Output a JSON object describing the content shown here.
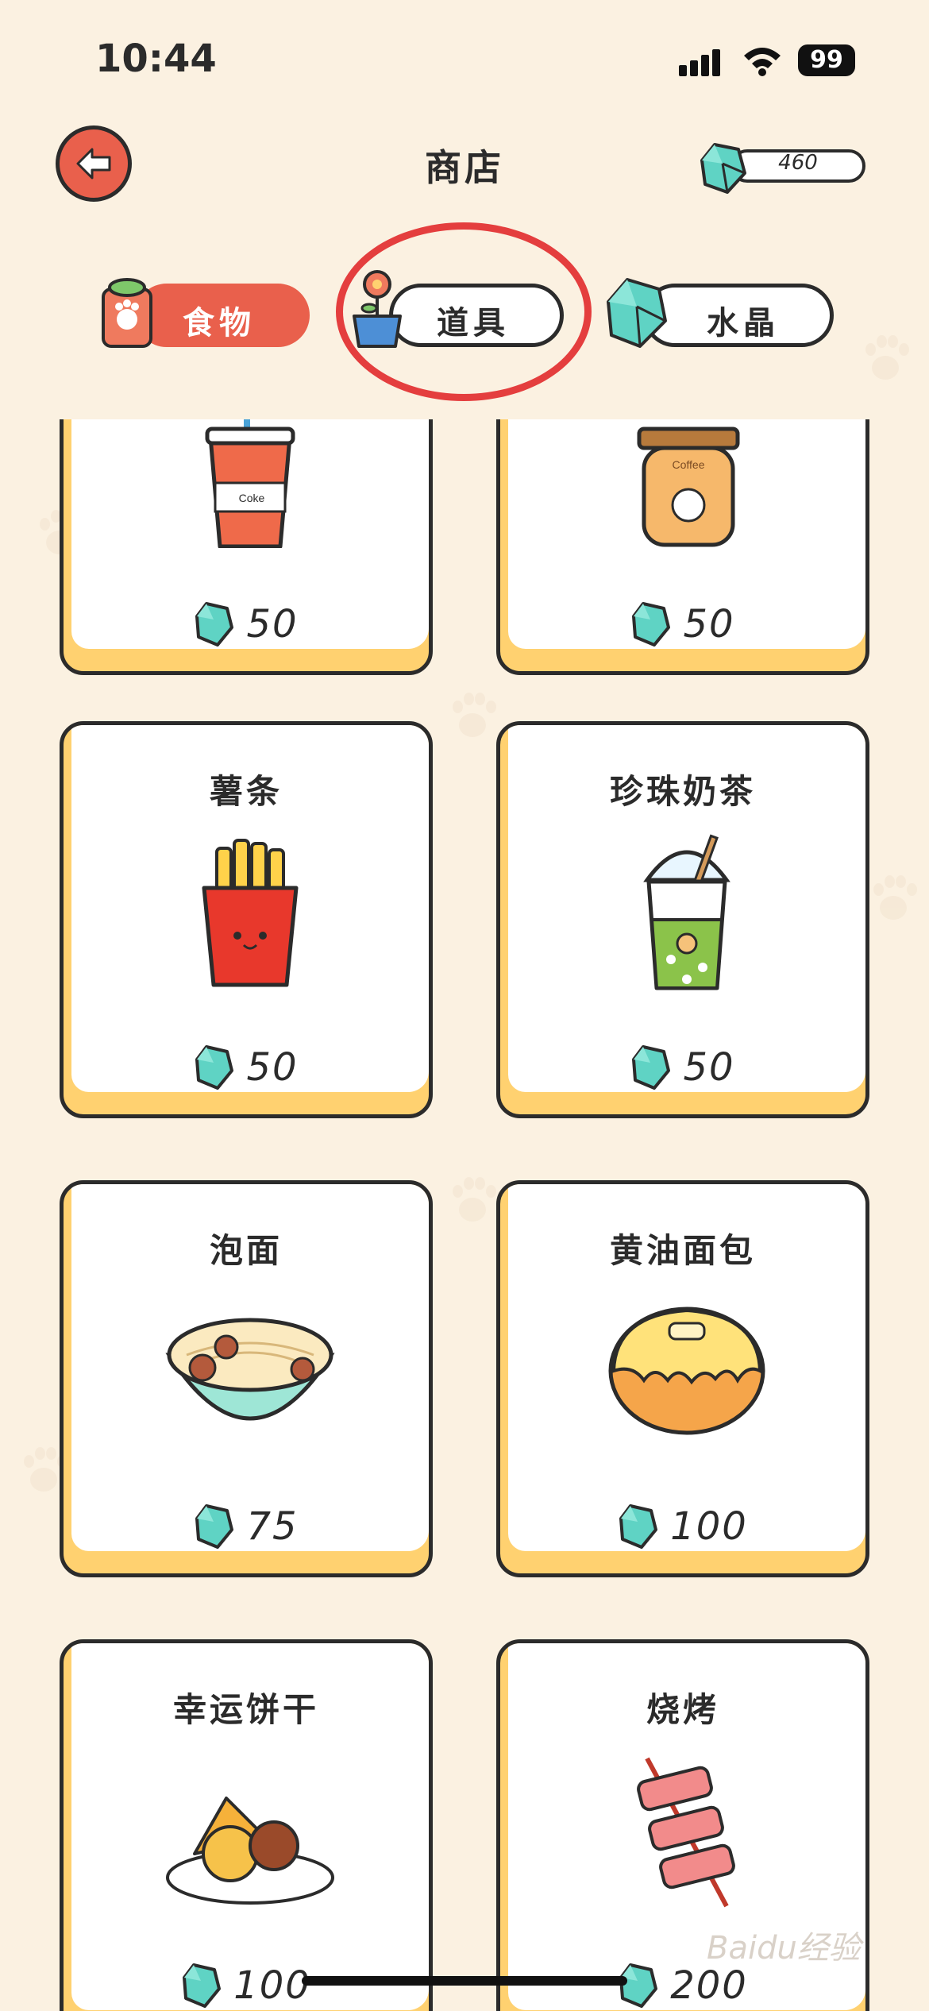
{
  "status_bar": {
    "time": "10:44",
    "battery": "99"
  },
  "header": {
    "title": "商店",
    "gem_balance": "460"
  },
  "tabs": [
    {
      "label": "食物",
      "active": true
    },
    {
      "label": "道具",
      "active": false
    },
    {
      "label": "水晶",
      "active": false
    }
  ],
  "items": [
    {
      "name": "",
      "price": "50",
      "icon": "cola-cup-icon"
    },
    {
      "name": "",
      "price": "50",
      "icon": "coffee-cup-icon"
    },
    {
      "name": "薯条",
      "price": "50",
      "icon": "french-fries-icon"
    },
    {
      "name": "珍珠奶茶",
      "price": "50",
      "icon": "bubble-tea-icon"
    },
    {
      "name": "泡面",
      "price": "75",
      "icon": "noodle-bowl-icon"
    },
    {
      "name": "黄油面包",
      "price": "100",
      "icon": "butter-bread-icon"
    },
    {
      "name": "幸运饼干",
      "price": "100",
      "icon": "fortune-cookie-icon"
    },
    {
      "name": "烧烤",
      "price": "200",
      "icon": "barbecue-icon"
    }
  ],
  "decor": {
    "cola_label": "Coke",
    "coffee_label": "Coffee",
    "watermark": "Baidu经验"
  },
  "colors": {
    "accent": "#e9604c",
    "card_base": "#ffd170",
    "gem": "#5fd3c4",
    "highlight": "#e43e3e"
  }
}
